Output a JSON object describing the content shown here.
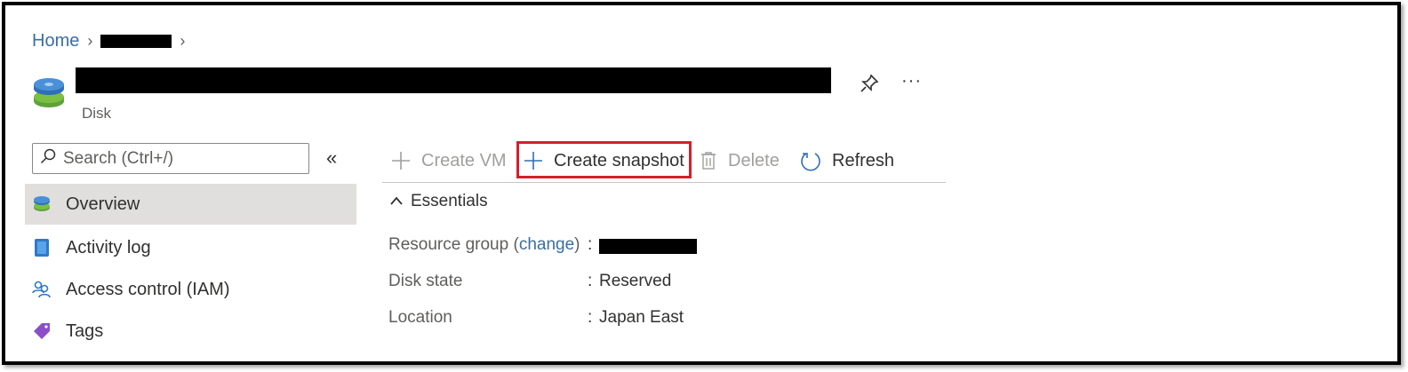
{
  "breadcrumb": {
    "home": "Home",
    "separator": "›"
  },
  "header": {
    "subtitle": "Disk",
    "more_label": "···",
    "icon": "disk-icon"
  },
  "search": {
    "placeholder": "Search (Ctrl+/)"
  },
  "sidebar": {
    "collapse_label": "«",
    "items": [
      {
        "label": "Overview",
        "icon": "disk-icon",
        "selected": true
      },
      {
        "label": "Activity log",
        "icon": "activity-log-icon",
        "selected": false
      },
      {
        "label": "Access control (IAM)",
        "icon": "people-icon",
        "selected": false
      },
      {
        "label": "Tags",
        "icon": "tag-icon",
        "selected": false
      }
    ]
  },
  "toolbar": {
    "create_vm": "Create VM",
    "create_snapshot": "Create snapshot",
    "delete": "Delete",
    "refresh": "Refresh"
  },
  "essentials": {
    "title": "Essentials",
    "resource_group_label": "Resource group",
    "change_link": "change",
    "disk_state_label": "Disk state",
    "disk_state_value": "Reserved",
    "location_label": "Location",
    "location_value": "Japan East",
    "colon": ":"
  },
  "colors": {
    "link": "#3a6ea5",
    "highlight_border": "#d41f2b",
    "selected_bg": "#e1dfdd",
    "disabled_text": "#a19f9d"
  }
}
